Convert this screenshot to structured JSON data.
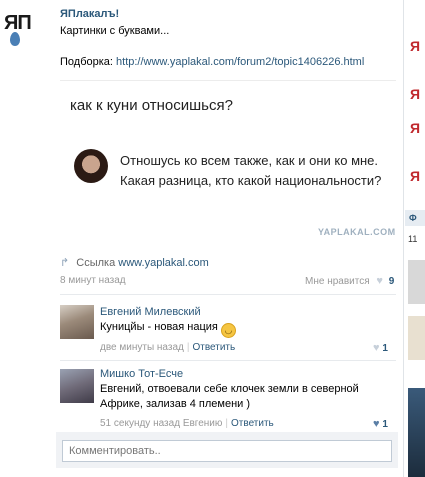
{
  "post": {
    "group_name": "ЯПлакалъ!",
    "text_line1": "Картинки с буквами...",
    "source_prefix": "Подборка:",
    "source_url": "http://www.yaplakal.com/forum2/topic1406226.html",
    "logo_text": "ЯП"
  },
  "image": {
    "question": "как к куни относишься?",
    "answer_line1": "Отношусь ко всем также, как и они ко мне.",
    "answer_line2": "Какая разница, кто какой национальности?",
    "watermark": "YAPLAKAL.COM"
  },
  "share": {
    "label": "Ссылка",
    "domain": "www.yaplakal.com",
    "time": "8 минут назад",
    "like_label": "Мне нравится",
    "like_count": "9"
  },
  "comments": [
    {
      "author": "Евгений Милевский",
      "text": "Куницйы - новая нация",
      "time": "две минуты назад",
      "action": "Ответить",
      "likes": "1"
    },
    {
      "author": "Мишко Тот-Есче",
      "text_line1": "Евгений, отвоевали себе клочек земли в северной",
      "text_line2": "Африке, зализав 4 племени )",
      "time": "51 секунду назад Евгению",
      "action": "Ответить",
      "likes": "1"
    }
  ],
  "comment_input": {
    "placeholder": "Комментировать.."
  },
  "right_column": {
    "label_f": "Ф",
    "label_11": "11",
    "mark": "Я"
  },
  "colors": {
    "link": "#2b587a",
    "muted": "#999999",
    "accent_red": "#c0282d"
  }
}
